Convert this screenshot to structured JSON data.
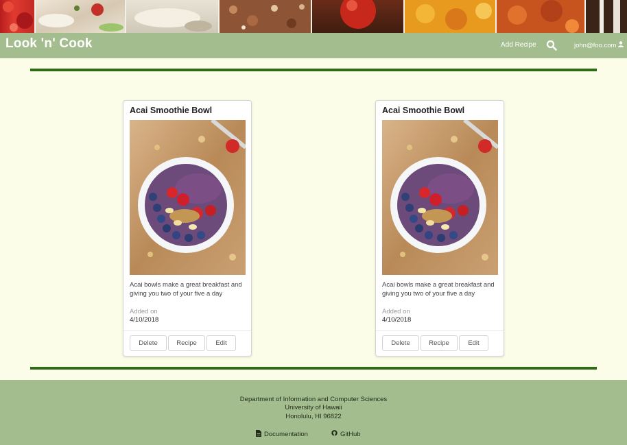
{
  "navbar": {
    "brand": "Look 'n' Cook",
    "add_recipe": "Add Recipe",
    "search_icon": "search-icon",
    "user_email": "john@foo.com",
    "user_icon": "user-icon"
  },
  "cards": [
    {
      "title": "Acai Smoothie Bowl",
      "image": "acai-bowl-photo",
      "description": "Acai bowls make a great breakfast and giving you two of your five a day",
      "added_label": "Added on",
      "added_date": "4/10/2018",
      "buttons": {
        "delete": "Delete",
        "recipe": "Recipe",
        "edit": "Edit"
      }
    },
    {
      "title": "Acai Smoothie Bowl",
      "image": "acai-bowl-photo",
      "description": "Acai bowls make a great breakfast and giving you two of your five a day",
      "added_label": "Added on",
      "added_date": "4/10/2018",
      "buttons": {
        "delete": "Delete",
        "recipe": "Recipe",
        "edit": "Edit"
      }
    }
  ],
  "footer": {
    "line1": "Department of Information and Computer Sciences",
    "line2": "University of Hawaii",
    "line3": "Honolulu, HI 96822",
    "docs_label": "Documentation",
    "docs_icon": "file-icon",
    "github_label": "GitHub",
    "github_icon": "github-icon"
  },
  "colors": {
    "nav_bg": "#a4bd8f",
    "page_bg": "#fbfde8",
    "rule": "#2f6a16"
  }
}
